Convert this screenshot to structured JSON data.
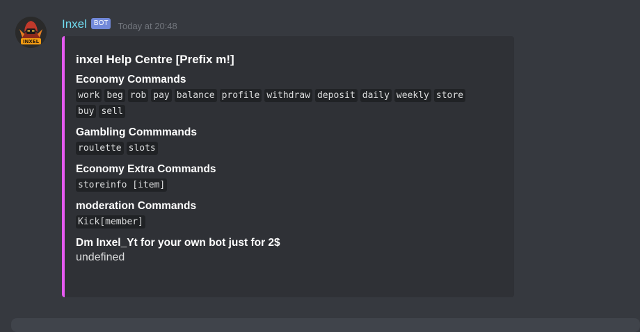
{
  "message": {
    "username": "Inxel",
    "bot_tag": "BOT",
    "timestamp": "Today at 20:48",
    "avatar_label": "INXEL",
    "accent_color": "#e75af2",
    "username_color": "#71dcf0",
    "avatar_icon": "hooded-character-avatar-icon"
  },
  "embed": {
    "title": "inxel  Help Centre [Prefix m!]",
    "fields": [
      {
        "name": "Economy Commands",
        "chips": [
          "work",
          "beg",
          "rob",
          "pay",
          "balance",
          "profile",
          "withdraw",
          "deposit",
          "daily",
          "weekly",
          "store",
          "buy",
          "sell"
        ]
      },
      {
        "name": "Gambling Commmands",
        "chips": [
          "roulette",
          "slots"
        ]
      },
      {
        "name": "Economy Extra Commands",
        "chips": [
          "storeinfo [item]"
        ]
      },
      {
        "name": "moderation Commands",
        "chips": [
          "Kick[member]"
        ]
      },
      {
        "name": "Dm Inxel_Yt for your own bot just for 2$",
        "text": "undefined"
      }
    ]
  }
}
